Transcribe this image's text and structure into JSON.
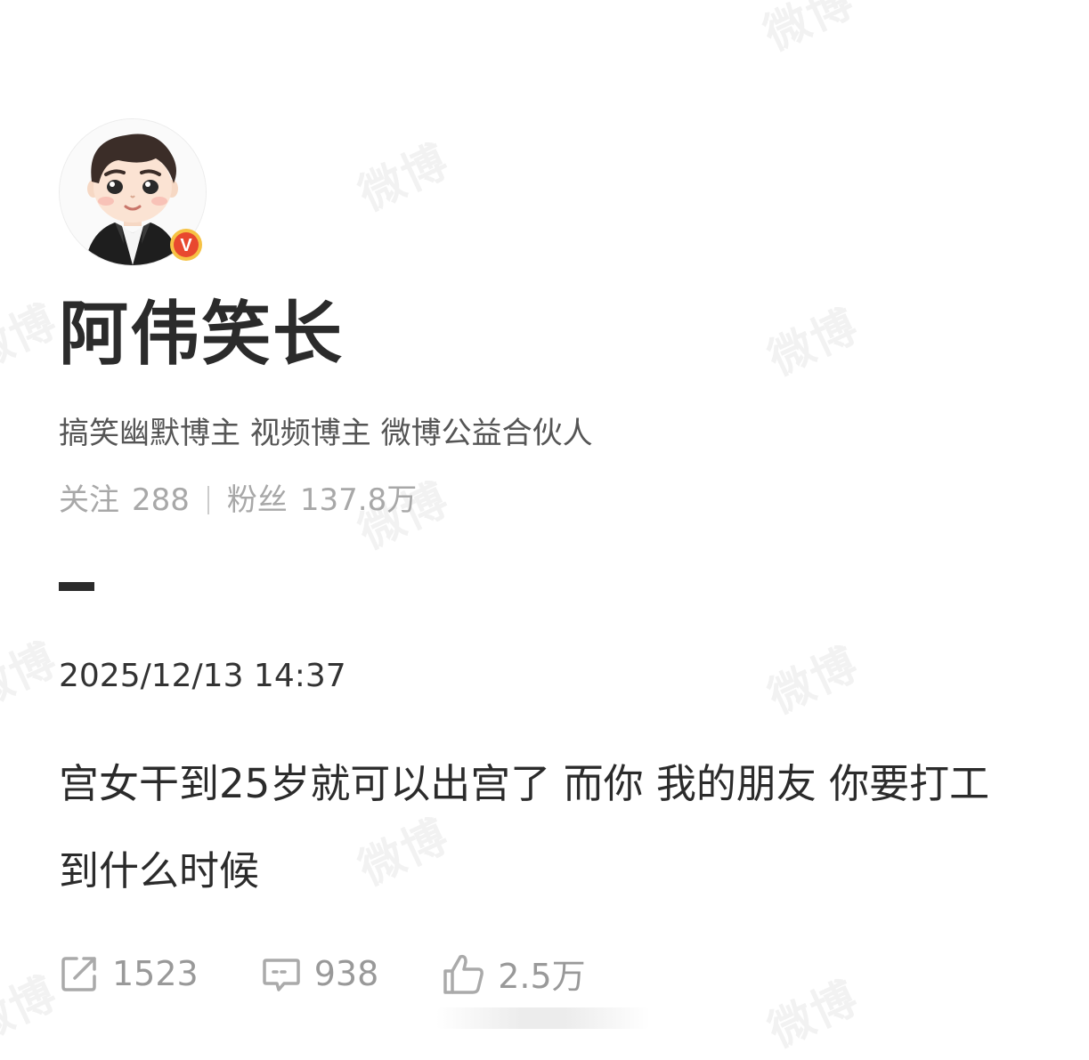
{
  "profile": {
    "name": "阿伟笑长",
    "tags": "搞笑幽默博主 视频博主 微博公益合伙人",
    "following_label": "关注",
    "following_count": "288",
    "followers_label": "粉丝",
    "followers_count": "137.8万",
    "verified_mark": "V"
  },
  "post": {
    "time": "2025/12/13 14:37",
    "text": "宫女干到25岁就可以出宫了 而你 我的朋友 你要打工到什么时候"
  },
  "actions": {
    "share_count": "1523",
    "comment_count": "938",
    "like_count": "2.5万"
  },
  "watermark_text": "微博",
  "icons": {
    "share": "share-icon",
    "comment": "comment-icon",
    "like": "thumbs-up-icon",
    "verified": "verified-badge-icon"
  },
  "colors": {
    "text_dark": "#2b2b2b",
    "text_gray": "#a8a8a8",
    "badge_orange": "#f39c12",
    "badge_red": "#e8482f"
  }
}
